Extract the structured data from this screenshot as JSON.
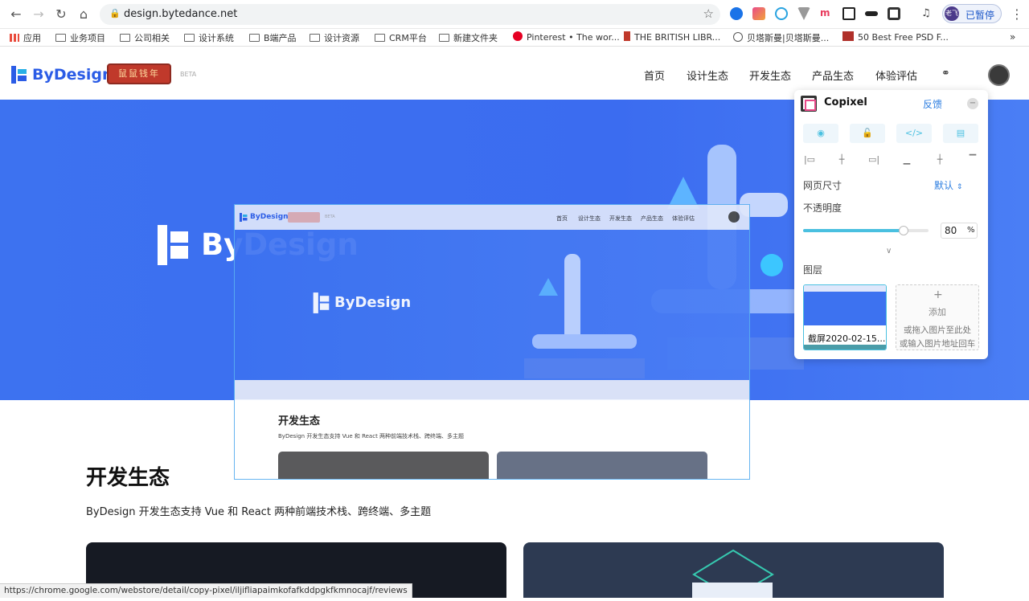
{
  "browser": {
    "url": "design.bytedance.net",
    "profile_status": "已暂停",
    "profile_initials": "老飞",
    "status_url": "https://chrome.google.com/webstore/detail/copy-pixel/iljifliapaimkofafkddpgkfkmnocajf/reviews"
  },
  "bookmarks": [
    {
      "label": "应用",
      "icon": "apps-grid-icon"
    },
    {
      "label": "业务项目",
      "icon": "folder-icon"
    },
    {
      "label": "公司相关",
      "icon": "folder-icon"
    },
    {
      "label": "设计系统",
      "icon": "folder-icon"
    },
    {
      "label": "B端产品",
      "icon": "folder-icon"
    },
    {
      "label": "设计资源",
      "icon": "folder-icon"
    },
    {
      "label": "CRM平台",
      "icon": "folder-icon"
    },
    {
      "label": "新建文件夹",
      "icon": "folder-icon"
    },
    {
      "label": "Pinterest • The wor...",
      "icon": "pinterest-icon"
    },
    {
      "label": "THE BRITISH LIBR...",
      "icon": "british-library-icon"
    },
    {
      "label": "贝塔斯曼|贝塔斯曼...",
      "icon": "globe-icon"
    },
    {
      "label": "50 Best Free PSD F...",
      "icon": "psd-icon"
    }
  ],
  "site": {
    "logo": "ByDesign",
    "badge": "鼠鼠钱年",
    "beta": "BETA",
    "nav": [
      "首页",
      "设计生态",
      "开发生态",
      "产品生态",
      "体验评估"
    ],
    "hero_logo": "ByDesign",
    "section_title": "开发生态",
    "section_desc": "ByDesign 开发生态支持 Vue 和 React 两种前端技术栈、跨终端、多主题"
  },
  "overlay": {
    "logo": "ByDesign",
    "beta": "BETA",
    "nav": [
      "首页",
      "设计生态",
      "开发生态",
      "产品生态",
      "体验评估"
    ],
    "hero_logo": "ByDesign",
    "section_title": "开发生态",
    "section_desc": "ByDesign 开发生态支持 Vue 和 React 两种前端技术栈、跨终端、多主题"
  },
  "copixel": {
    "title": "Copixel",
    "feedback": "反馈",
    "page_size_label": "网页尺寸",
    "page_size_value": "默认",
    "opacity_label": "不透明度",
    "opacity_value": "80",
    "opacity_unit": "%",
    "opacity": 0.8,
    "layers_label": "图层",
    "layer_name": "截屏2020-02-15...",
    "add_label": "添加",
    "add_hint_1": "或拖入图片至此处",
    "add_hint_2": "或输入图片地址回车"
  },
  "colors": {
    "brand": "#2b5ce6",
    "hero_bg": "#3d72f0",
    "copixel_accent": "#4ac0e0"
  }
}
